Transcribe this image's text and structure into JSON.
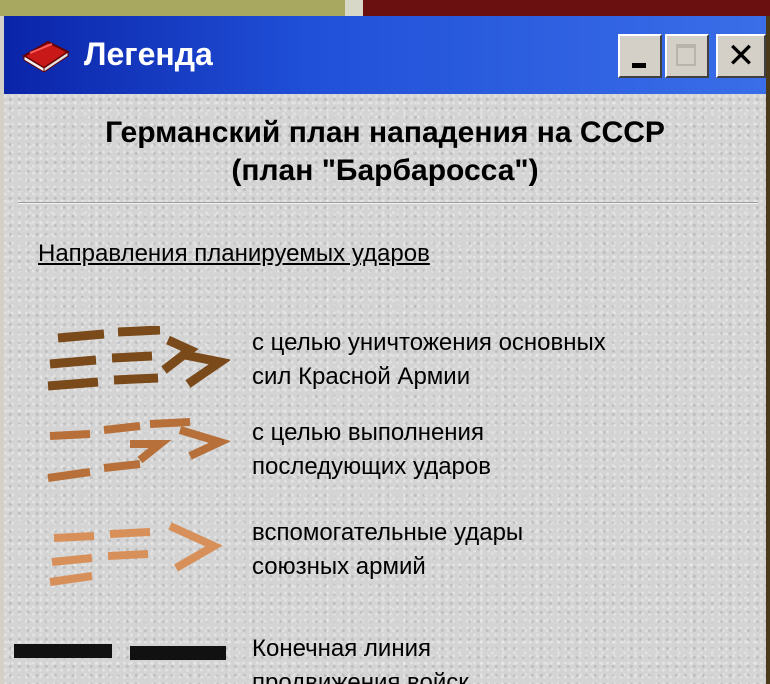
{
  "window": {
    "title": "Легенда"
  },
  "legend": {
    "heading_line1": "Германский план нападения на СССР",
    "heading_line2": "(план \"Барбаросса\")",
    "section_title": "Направления планируемых ударов",
    "items": [
      {
        "line1": "с целью уничтожения основных",
        "line2": "сил Красной Армии",
        "color": "#7a4a1a"
      },
      {
        "line1": "с целью выполнения",
        "line2": "последующих ударов",
        "color": "#b8703a"
      },
      {
        "line1": "вспомогательные удары",
        "line2": "союзных армий",
        "color": "#d8905a"
      },
      {
        "line1": "Конечная линия",
        "line2": "продвижения войск",
        "color": "#111111"
      }
    ]
  },
  "colors": {
    "titlebar": "#0a24a8",
    "window_bg": "#d4d4d4"
  }
}
